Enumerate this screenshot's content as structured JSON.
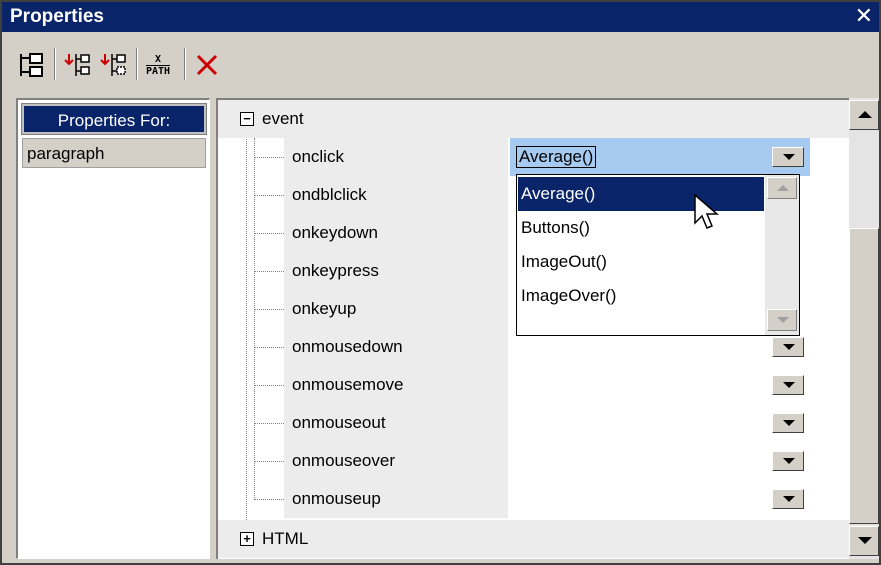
{
  "window": {
    "title": "Properties",
    "close_glyph": "✕"
  },
  "toolbar": {
    "buttons": [
      "tree-view-icon",
      "add-child-icon",
      "add-sibling-icon",
      "xpath-icon",
      "delete-icon"
    ],
    "xpath_top": "X",
    "xpath_bottom": "PATH",
    "delete_glyph": "✕"
  },
  "left_pane": {
    "header": "Properties For:",
    "items": [
      "paragraph"
    ]
  },
  "tree": {
    "groups": [
      {
        "label": "event",
        "expander": "−",
        "expanded": true
      },
      {
        "label": "HTML",
        "expander": "+",
        "expanded": false
      }
    ],
    "properties": [
      {
        "name": "onclick",
        "value": "Average()"
      },
      {
        "name": "ondblclick",
        "value": ""
      },
      {
        "name": "onkeydown",
        "value": ""
      },
      {
        "name": "onkeypress",
        "value": ""
      },
      {
        "name": "onkeyup",
        "value": ""
      },
      {
        "name": "onmousedown",
        "value": ""
      },
      {
        "name": "onmousemove",
        "value": ""
      },
      {
        "name": "onmouseout",
        "value": ""
      },
      {
        "name": "onmouseover",
        "value": ""
      },
      {
        "name": "onmouseup",
        "value": ""
      }
    ]
  },
  "dropdown": {
    "options": [
      "Average()",
      "Buttons()",
      "ImageOut()",
      "ImageOver()"
    ],
    "selected": "Average()"
  },
  "colors": {
    "title_bar": "#0a246a",
    "selection": "#0a246a",
    "value_highlight": "#a6caf0",
    "delete_red": "#cc0000"
  }
}
